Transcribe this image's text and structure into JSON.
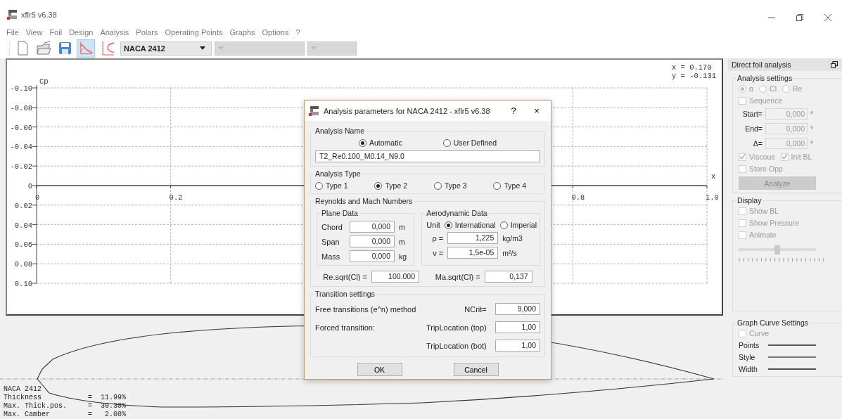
{
  "window": {
    "title": "xflr5 v6.38"
  },
  "menu": [
    "File",
    "View",
    "Foil",
    "Design",
    "Analysis",
    "Polars",
    "Operating Points",
    "Graphs",
    "Options",
    "?"
  ],
  "toolbar": {
    "tools": [
      {
        "selected": false
      },
      {
        "selected": false
      },
      {
        "selected": false
      },
      {
        "selected": true
      },
      {
        "selected": false
      }
    ],
    "combos": [
      {
        "value": "NACA 2412",
        "disabled": false
      },
      {
        "disabled": true
      },
      {
        "disabled": true
      }
    ]
  },
  "cp_graph": {
    "cursor": [
      "x =  0.170",
      "y = -0.131"
    ],
    "chart_data": {
      "type": "line",
      "grid": true,
      "xlabel": "x",
      "ylabel": "Cp",
      "xlim": [
        0,
        1
      ],
      "ylim": [
        0.1,
        -0.1
      ],
      "xticks": [
        {
          "value": 0,
          "label": "0"
        },
        {
          "value": 0.2,
          "label": "0.2"
        },
        {
          "value": 0.8,
          "label": "0.8"
        },
        {
          "value": 1,
          "label": "1.0"
        }
      ],
      "yticks": [
        {
          "value": -0.1,
          "label": "-0.10"
        },
        {
          "value": -0.08,
          "label": "-0.08"
        },
        {
          "value": -0.06,
          "label": "-0.06"
        },
        {
          "value": -0.04,
          "label": "-0.04"
        },
        {
          "value": -0.02,
          "label": "-0.02"
        },
        {
          "value": 0,
          "label": "0"
        },
        {
          "value": 0.02,
          "label": "0.02"
        },
        {
          "value": 0.04,
          "label": "0.04"
        },
        {
          "value": 0.06,
          "label": "0.06"
        },
        {
          "value": 0.08,
          "label": "0.08"
        },
        {
          "value": 0.1,
          "label": "0.10"
        }
      ]
    }
  },
  "foil_view": {
    "lines": [
      {
        "label": "NACA 2412"
      },
      {
        "label": "Thickness",
        "value": "=  11.99%"
      },
      {
        "label": "Max. Thick.pos.",
        "value": "=  30.30%"
      },
      {
        "label": "Max. Camber",
        "value": "=   2.00%"
      }
    ]
  },
  "dialog": {
    "title": "Analysis parameters for NACA 2412 - xflr5 v6.38",
    "help": "?",
    "close": "×",
    "analysis_name": {
      "title": "Analysis Name",
      "options": [
        {
          "label": "Automatic",
          "selected": true
        },
        {
          "label": "User Defined",
          "selected": false
        }
      ],
      "value": "T2_Re0.100_M0.14_N9.0"
    },
    "analysis_type": {
      "title": "Analysis Type",
      "options": [
        {
          "label": "Type 1",
          "selected": false
        },
        {
          "label": "Type 2",
          "selected": true
        },
        {
          "label": "Type 3",
          "selected": false
        },
        {
          "label": "Type 4",
          "selected": false
        }
      ]
    },
    "reynolds": {
      "title": "Reynolds and Mach Numbers",
      "plane": {
        "title": "Plane Data",
        "fields": [
          {
            "label": "Chord",
            "value": "0,000",
            "unit": "m"
          },
          {
            "label": "Span",
            "value": "0,000",
            "unit": "m"
          },
          {
            "label": "Mass",
            "value": "0,000",
            "unit": "kg"
          }
        ]
      },
      "aero": {
        "title": "Aerodynamic Data",
        "unit_label": "Unit",
        "units": [
          {
            "label": "International",
            "selected": true
          },
          {
            "label": "Imperial",
            "selected": false
          }
        ],
        "fields": [
          {
            "label": "ρ =",
            "value": "1,225",
            "unit": "kg/m3"
          },
          {
            "label": "ν =",
            "value": "1,5e-05",
            "unit": "m²/s"
          }
        ]
      },
      "results": [
        {
          "label": "Re.sqrt(Cl) =",
          "value": "100.000"
        },
        {
          "label": "Ma.sqrt(Cl) =",
          "value": "0,137"
        }
      ]
    },
    "transition": {
      "title": "Transition settings",
      "rows": [
        {
          "label": "Free transitions (e^n) method",
          "field_label": "NCrit=",
          "value": "9,000"
        },
        {
          "label": "Forced transition:",
          "field_label": "TripLocation (top)",
          "value": "1,00"
        },
        {
          "field_label": "TripLocation (bot)",
          "value": "1,00"
        }
      ]
    },
    "buttons": [
      "OK",
      "Cancel"
    ]
  },
  "side_panel": {
    "title": "Direct foil analysis",
    "analysis_settings": {
      "title": "Analysis settings",
      "modes": [
        {
          "label": "α",
          "selected": true,
          "disabled": true
        },
        {
          "label": "Cl",
          "selected": false,
          "disabled": true
        },
        {
          "label": "Re",
          "selected": false,
          "disabled": true
        }
      ],
      "sequence": {
        "label": "Sequence",
        "checked": false,
        "disabled": true
      },
      "fields": [
        {
          "label": "Start=",
          "value": "0,000",
          "unit": "°",
          "disabled": true
        },
        {
          "label": "End=",
          "value": "0,000",
          "unit": "°",
          "disabled": true
        },
        {
          "label": "Δ=",
          "value": "0,000",
          "unit": "°",
          "disabled": true
        }
      ],
      "checks": [
        {
          "label": "Viscous",
          "checked": true,
          "disabled": true
        },
        {
          "label": "Init BL",
          "checked": true,
          "disabled": true
        }
      ],
      "store": {
        "label": "Store Opp",
        "checked": false,
        "disabled": true
      },
      "analyze": {
        "label": "Analyze",
        "disabled": true
      }
    },
    "display": {
      "title": "Display",
      "checks": [
        {
          "label": "Show BL",
          "checked": false,
          "disabled": true
        },
        {
          "label": "Show Pressure",
          "checked": false,
          "disabled": true
        },
        {
          "label": "Animate",
          "checked": false,
          "disabled": true
        }
      ],
      "slider": {
        "level": 0.5
      }
    },
    "curve_settings": {
      "title": "Graph Curve Settings",
      "curve": {
        "label": "Curve",
        "checked": false,
        "disabled": true
      },
      "rows": [
        "Points",
        "Style",
        "Width"
      ]
    }
  }
}
